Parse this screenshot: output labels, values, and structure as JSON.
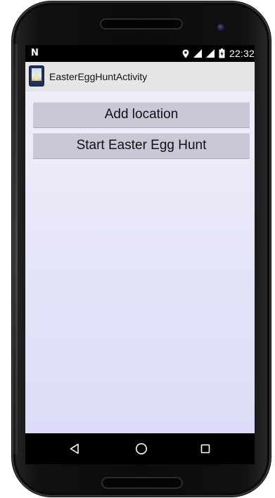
{
  "device": {
    "frame_color": "#111111",
    "icons": [
      "speaker-grille",
      "front-camera"
    ]
  },
  "status_bar": {
    "notification_icon": "N",
    "icons": [
      "location-icon",
      "signal-icon",
      "signal-icon",
      "battery-icon"
    ],
    "time": "22:32"
  },
  "action_bar": {
    "icon": "app-icon",
    "title": "EasterEggHuntActivity"
  },
  "main": {
    "buttons": [
      {
        "label": "Add location"
      },
      {
        "label": "Start Easter Egg Hunt"
      }
    ]
  },
  "nav_bar": {
    "buttons": [
      "back-icon",
      "home-icon",
      "recent-apps-icon"
    ]
  }
}
